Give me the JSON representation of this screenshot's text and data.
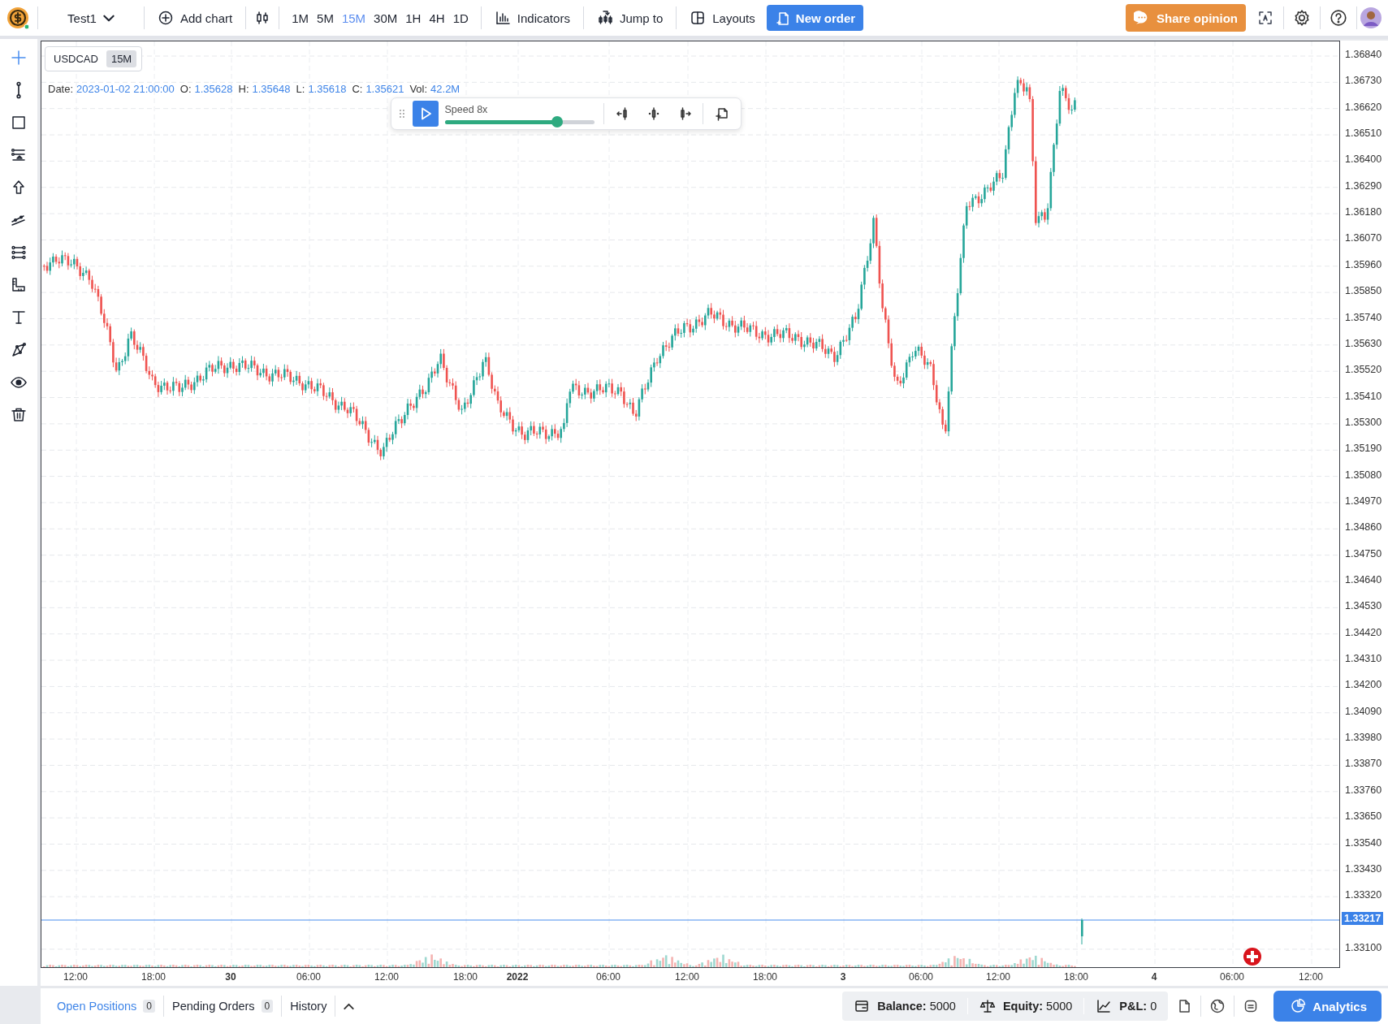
{
  "topbar": {
    "layout_name": "Test1",
    "add_chart": "Add chart",
    "timeframes": [
      {
        "label": "1M",
        "selected": false
      },
      {
        "label": "5M",
        "selected": false
      },
      {
        "label": "15M",
        "selected": true
      },
      {
        "label": "30M",
        "selected": false
      },
      {
        "label": "1H",
        "selected": false
      },
      {
        "label": "4H",
        "selected": false
      },
      {
        "label": "1D",
        "selected": false
      }
    ],
    "indicators": "Indicators",
    "jump_to": "Jump to",
    "layouts": "Layouts",
    "new_order": "New order",
    "share_opinion": "Share opinion"
  },
  "drawing_tools": [
    {
      "kind": "crosshair",
      "selected": true
    },
    {
      "kind": "line",
      "selected": false
    },
    {
      "kind": "rectangle",
      "selected": false
    },
    {
      "kind": "fibonacci",
      "selected": false
    },
    {
      "kind": "arrow",
      "selected": false
    },
    {
      "kind": "fan",
      "selected": false
    },
    {
      "kind": "channel",
      "selected": false
    },
    {
      "kind": "ruler",
      "selected": false
    },
    {
      "kind": "text",
      "selected": false
    },
    {
      "kind": "pattern",
      "selected": false
    },
    {
      "kind": "eye",
      "selected": false
    },
    {
      "kind": "trash",
      "selected": false
    }
  ],
  "chart": {
    "symbol": "USDCAD",
    "interval": "15M",
    "legend": [
      {
        "label": "Date:",
        "value": "2023-01-02 21:00:00"
      },
      {
        "label": "O:",
        "value": "1.35628"
      },
      {
        "label": "H:",
        "value": "1.35648"
      },
      {
        "label": "L:",
        "value": "1.35618"
      },
      {
        "label": "C:",
        "value": "1.35621"
      },
      {
        "label": "Vol:",
        "value": "42.2M"
      }
    ],
    "replay": {
      "speed_label": "Speed 8x",
      "level": 0.75,
      "playing": false
    },
    "price_axis": [
      "1.36840",
      "1.36730",
      "1.36620",
      "1.36510",
      "1.36400",
      "1.36290",
      "1.36180",
      "1.36070",
      "1.35960",
      "1.35850",
      "1.35740",
      "1.35630",
      "1.35520",
      "1.35410",
      "1.35300",
      "1.35190",
      "1.35080",
      "1.34970",
      "1.34860",
      "1.34750",
      "1.34640",
      "1.34530",
      "1.34420",
      "1.34310",
      "1.34200",
      "1.34090",
      "1.33980",
      "1.33870",
      "1.33760",
      "1.33650",
      "1.33540",
      "1.33430",
      "1.33320",
      "1.33100"
    ],
    "current_price": "1.33217",
    "time_axis": [
      {
        "label": "12:00",
        "major": false
      },
      {
        "label": "18:00",
        "major": false
      },
      {
        "label": "30",
        "major": true
      },
      {
        "label": "06:00",
        "major": false
      },
      {
        "label": "12:00",
        "major": false
      },
      {
        "label": "18:00",
        "major": false
      },
      {
        "label": "2022",
        "major": true
      },
      {
        "label": "06:00",
        "major": false
      },
      {
        "label": "12:00",
        "major": false
      },
      {
        "label": "18:00",
        "major": false
      },
      {
        "label": "3",
        "major": true
      },
      {
        "label": "06:00",
        "major": false
      },
      {
        "label": "12:00",
        "major": false
      },
      {
        "label": "18:00",
        "major": false
      },
      {
        "label": "4",
        "major": true
      },
      {
        "label": "06:00",
        "major": false
      },
      {
        "label": "12:00",
        "major": false
      }
    ]
  },
  "bottom_bar": {
    "tabs": [
      {
        "label": "Open Positions",
        "count": "0",
        "selected": true
      },
      {
        "label": "Pending Orders",
        "count": "0",
        "selected": false
      },
      {
        "label": "History",
        "selected": false
      }
    ],
    "stats": [
      {
        "kind": "balance",
        "text": "**Balance:** 5000"
      },
      {
        "kind": "equity",
        "text": "**Equity:** 5000"
      },
      {
        "kind": "pnl",
        "text": "**P&L:** 0"
      }
    ],
    "analytics": "Analytics"
  }
}
